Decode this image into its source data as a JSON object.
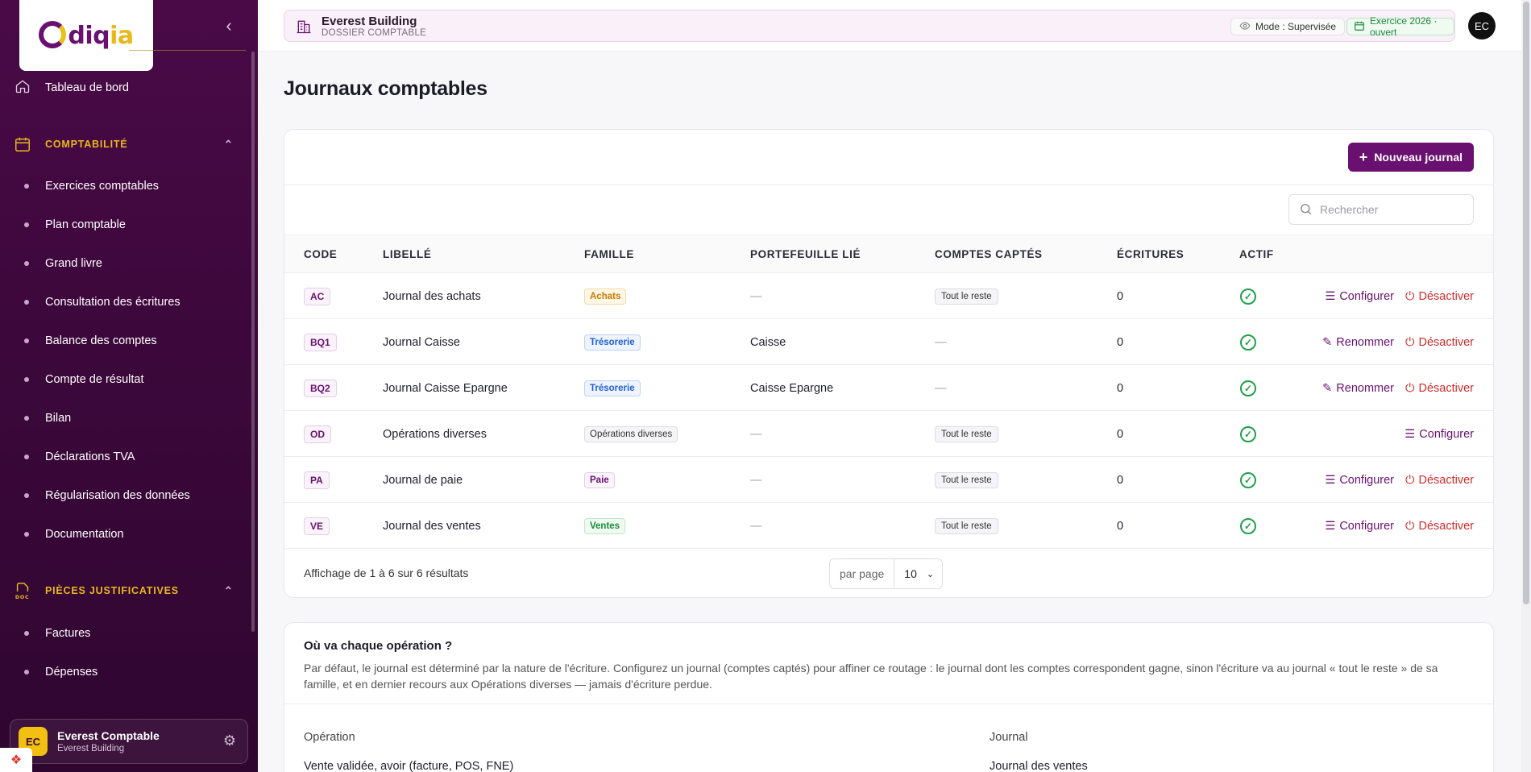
{
  "app": {
    "logo": "ediqia"
  },
  "sidebar": {
    "dashboard": "Tableau de bord",
    "sections": [
      {
        "title": "COMPTABILITÉ",
        "items": [
          "Exercices comptables",
          "Plan comptable",
          "Grand livre",
          "Consultation des écritures",
          "Balance des comptes",
          "Compte de résultat",
          "Bilan",
          "Déclarations TVA",
          "Régularisation des données",
          "Documentation"
        ]
      },
      {
        "title": "PIÈCES JUSTIFICATIVES",
        "items": [
          "Factures",
          "Dépenses"
        ]
      }
    ],
    "user": {
      "initials": "EC",
      "name": "Everest Comptable",
      "company": "Everest Building"
    }
  },
  "topbar": {
    "company": "Everest Building",
    "subtitle": "DOSSIER COMPTABLE",
    "mode": "Mode : Supervisée",
    "exercise": "Exercice 2026 · ouvert",
    "avatar": "EC"
  },
  "page": {
    "title": "Journaux comptables",
    "new_button": "Nouveau journal",
    "search_placeholder": "Rechercher",
    "columns": [
      "CODE",
      "LIBELLÉ",
      "FAMILLE",
      "PORTEFEUILLE LIÉ",
      "COMPTES CAPTÉS",
      "ÉCRITURES",
      "ACTIF"
    ],
    "rows": [
      {
        "code": "AC",
        "label": "Journal des achats",
        "famille": "Achats",
        "portefeuille": "—",
        "comptes": "Tout le reste",
        "ecritures": "0",
        "actions": [
          "Configurer",
          "Désactiver"
        ]
      },
      {
        "code": "BQ1",
        "label": "Journal Caisse",
        "famille": "Trésorerie",
        "portefeuille": "Caisse",
        "comptes": "—",
        "ecritures": "0",
        "actions": [
          "Renommer",
          "Désactiver"
        ]
      },
      {
        "code": "BQ2",
        "label": "Journal Caisse Epargne",
        "famille": "Trésorerie",
        "portefeuille": "Caisse Epargne",
        "comptes": "—",
        "ecritures": "0",
        "actions": [
          "Renommer",
          "Désactiver"
        ]
      },
      {
        "code": "OD",
        "label": "Opérations diverses",
        "famille": "Opérations diverses",
        "portefeuille": "—",
        "comptes": "Tout le reste",
        "ecritures": "0",
        "actions": [
          "Configurer"
        ]
      },
      {
        "code": "PA",
        "label": "Journal de paie",
        "famille": "Paie",
        "portefeuille": "—",
        "comptes": "Tout le reste",
        "ecritures": "0",
        "actions": [
          "Configurer",
          "Désactiver"
        ]
      },
      {
        "code": "VE",
        "label": "Journal des ventes",
        "famille": "Ventes",
        "portefeuille": "—",
        "comptes": "Tout le reste",
        "ecritures": "0",
        "actions": [
          "Configurer",
          "Désactiver"
        ]
      }
    ],
    "pagination": {
      "info": "Affichage de 1 à 6 sur 6 résultats",
      "per_page_label": "par page",
      "per_page_value": "10"
    }
  },
  "routing": {
    "title": "Où va chaque opération ?",
    "description": "Par défaut, le journal est déterminé par la nature de l'écriture. Configurez un journal (comptes captés) pour affiner ce routage : le journal dont les comptes correspondent gagne, sinon l'écriture va au journal « tout le reste » de sa famille, et en dernier recours aux Opérations diverses — jamais d'écriture perdue.",
    "col_operation": "Opération",
    "col_journal": "Journal",
    "first_row": {
      "operation": "Vente validée, avoir (facture, POS, FNE)",
      "journal": "Journal des ventes"
    }
  },
  "colors": {
    "brand": "#6a1070",
    "accent": "#e9b81c",
    "danger": "#d22b2b",
    "success": "#21a04a"
  }
}
